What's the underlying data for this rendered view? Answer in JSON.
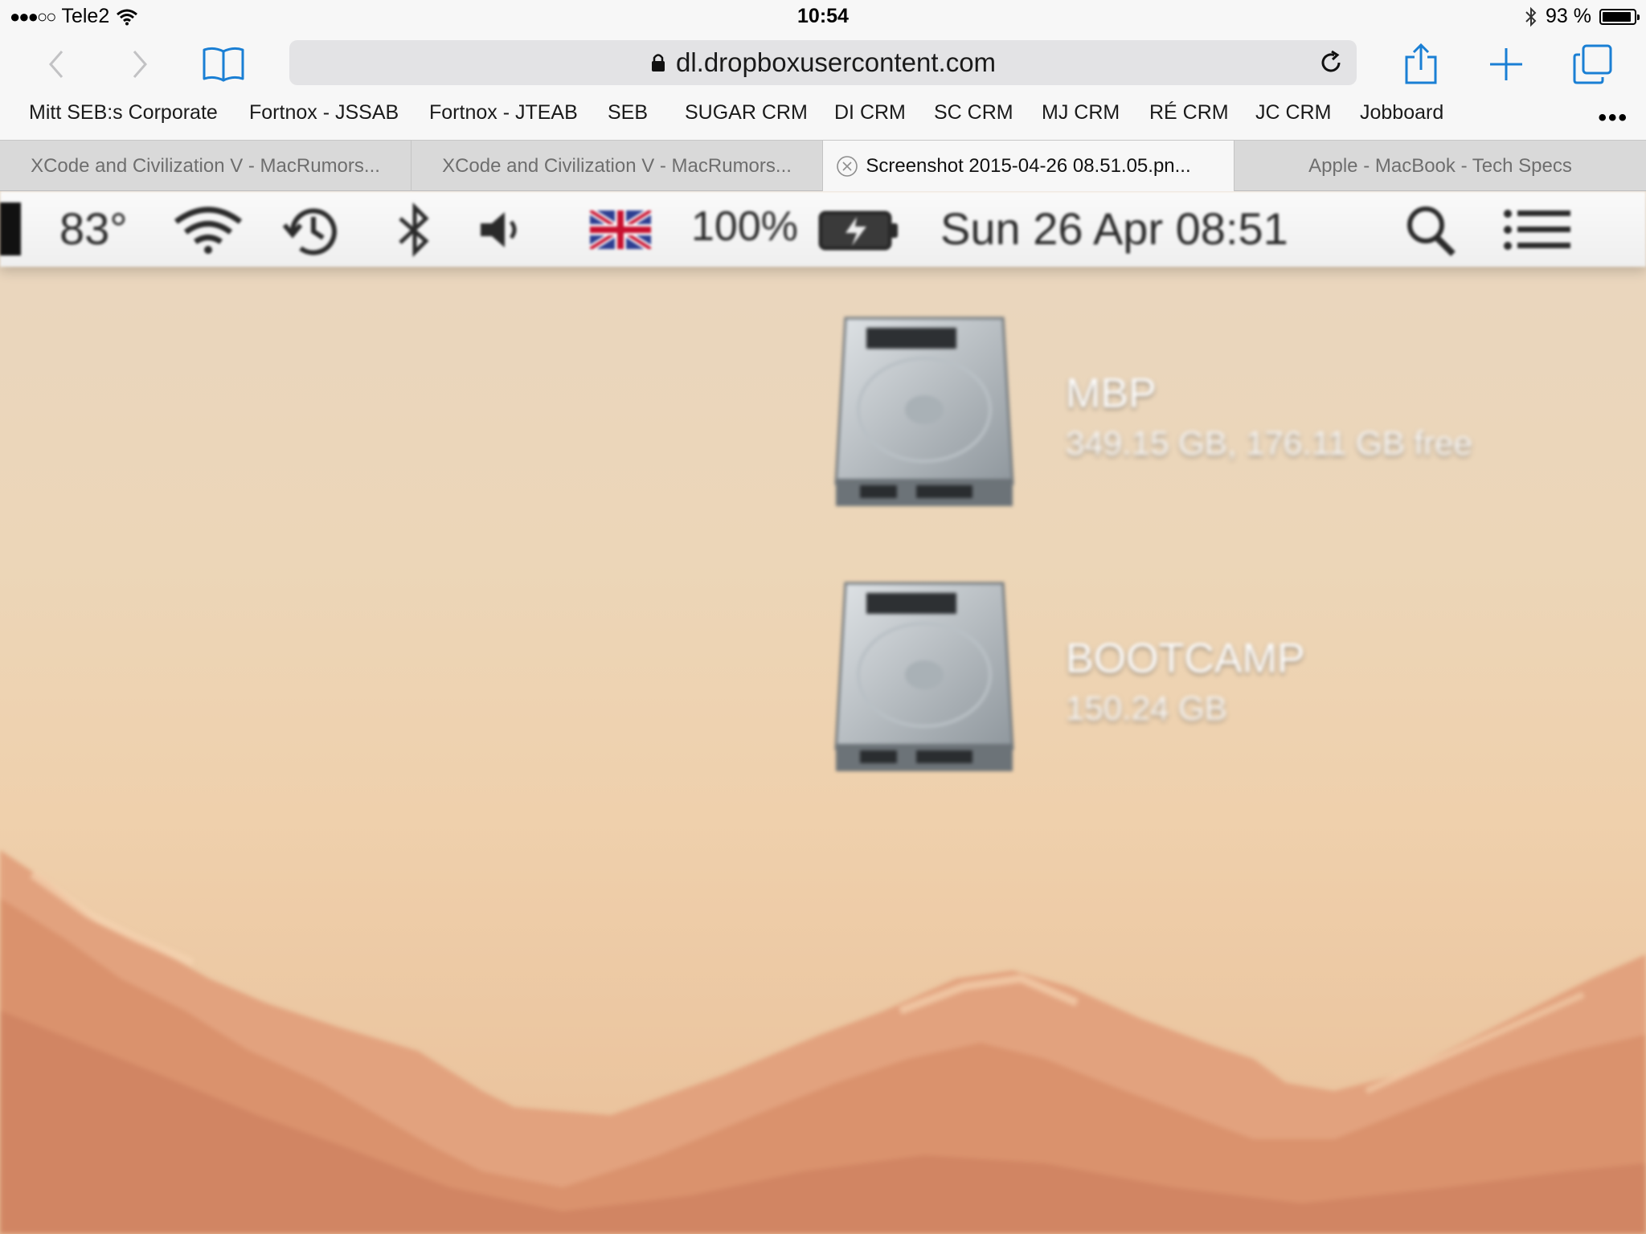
{
  "status_bar": {
    "signal": "●●●○○",
    "carrier": "Tele2",
    "time": "10:54",
    "battery_text": "93 %",
    "battery_level": 0.93
  },
  "toolbar": {
    "url": "dl.dropboxusercontent.com",
    "icons": {
      "back": "chevron-left-icon",
      "forward": "chevron-right-icon",
      "bookmarks": "book-icon",
      "share": "share-icon",
      "new_tab": "plus-icon",
      "tabs": "tabs-icon"
    },
    "accent_color": "#1a7fd4"
  },
  "bookmarks": [
    "Mitt SEB:s Corporate",
    "Fortnox - JSSAB",
    "Fortnox - JTEAB",
    "SEB",
    "SUGAR CRM",
    "DI CRM",
    "SC CRM",
    "MJ CRM",
    "RÉ CRM",
    "JC CRM",
    "Jobboard"
  ],
  "bookmarks_more": "•••",
  "tabs": [
    {
      "title": "XCode and Civilization V - MacRumors...",
      "active": false
    },
    {
      "title": "XCode and Civilization V - MacRumors...",
      "active": false
    },
    {
      "title": "Screenshot 2015-04-26 08.51.05.pn...",
      "active": true
    },
    {
      "title": "Apple - MacBook - Tech Specs",
      "active": false
    }
  ],
  "screenshot": {
    "menubar": {
      "temperature": "83°",
      "battery": "100%",
      "datetime": "Sun 26 Apr  08:51"
    },
    "drives": [
      {
        "name": "MBP",
        "info": "349.15 GB, 176.11 GB free"
      },
      {
        "name": "BOOTCAMP",
        "info": "150.24 GB"
      }
    ]
  }
}
